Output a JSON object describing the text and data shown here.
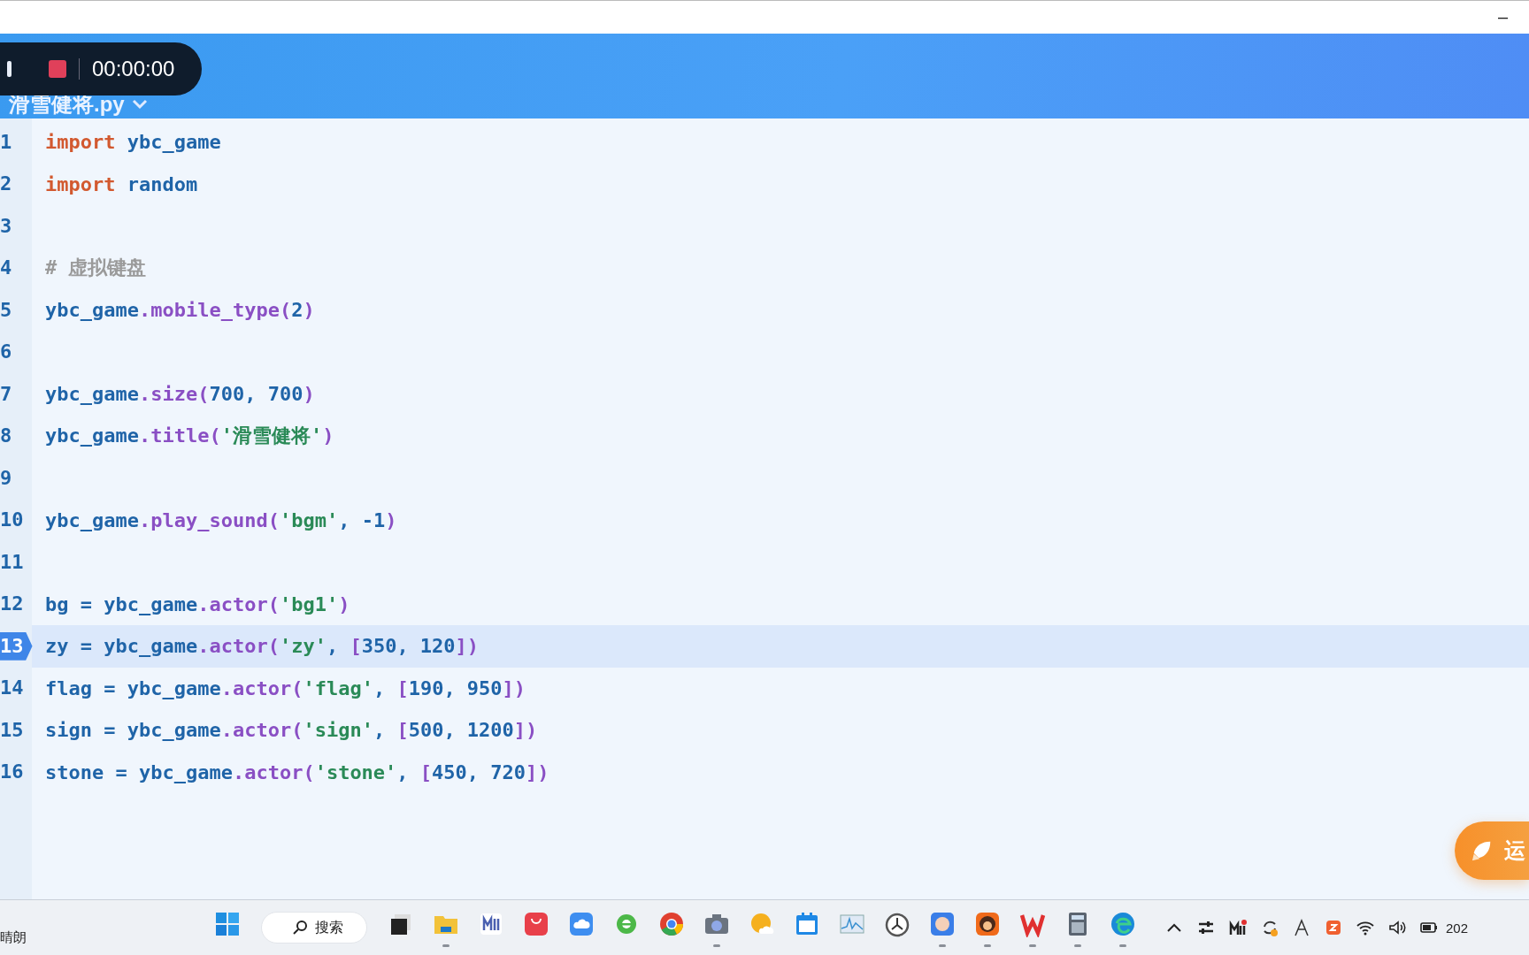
{
  "window": {
    "minimize": "–"
  },
  "recorder": {
    "time": "00:00:00"
  },
  "file_tab": {
    "title": "滑雪健将.py"
  },
  "editor": {
    "lines": [
      {
        "number": "1",
        "current": false,
        "tokens": [
          {
            "kind": "kw",
            "text": "import"
          },
          {
            "kind": "name",
            "text": " ybc_game"
          }
        ]
      },
      {
        "number": "2",
        "current": false,
        "tokens": [
          {
            "kind": "kw",
            "text": "import"
          },
          {
            "kind": "name",
            "text": " random"
          }
        ]
      },
      {
        "number": "3",
        "current": false
      },
      {
        "number": "4",
        "current": false,
        "tokens": [
          {
            "kind": "comment",
            "text": "# 虚拟键盘"
          }
        ]
      },
      {
        "number": "5",
        "current": false,
        "tokens": [
          {
            "kind": "name",
            "text": "ybc_game"
          },
          {
            "kind": "fn",
            "text": ".mobile_type("
          },
          {
            "kind": "num",
            "text": "2"
          },
          {
            "kind": "fn",
            "text": ")"
          }
        ]
      },
      {
        "number": "6",
        "current": false
      },
      {
        "number": "7",
        "current": false,
        "tokens": [
          {
            "kind": "name",
            "text": "ybc_game"
          },
          {
            "kind": "fn",
            "text": ".size("
          },
          {
            "kind": "num",
            "text": "700, 700"
          },
          {
            "kind": "fn",
            "text": ")"
          }
        ]
      },
      {
        "number": "8",
        "current": false,
        "tokens": [
          {
            "kind": "name",
            "text": "ybc_game"
          },
          {
            "kind": "fn",
            "text": ".title("
          },
          {
            "kind": "str",
            "text": "'滑雪健将'"
          },
          {
            "kind": "fn",
            "text": ")"
          }
        ]
      },
      {
        "number": "9",
        "current": false
      },
      {
        "number": "10",
        "current": false,
        "tokens": [
          {
            "kind": "name",
            "text": "ybc_game"
          },
          {
            "kind": "fn",
            "text": ".play_sound("
          },
          {
            "kind": "str",
            "text": "'bgm'"
          },
          {
            "kind": "num",
            "text": ", -1"
          },
          {
            "kind": "fn",
            "text": ")"
          }
        ]
      },
      {
        "number": "11",
        "current": false
      },
      {
        "number": "12",
        "current": false,
        "tokens": [
          {
            "kind": "name",
            "text": "bg = ybc_game"
          },
          {
            "kind": "fn",
            "text": ".actor("
          },
          {
            "kind": "str",
            "text": "'bg1'"
          },
          {
            "kind": "fn",
            "text": ")"
          }
        ]
      },
      {
        "number": "13",
        "current": true,
        "tokens": [
          {
            "kind": "name",
            "text": "zy = ybc_game"
          },
          {
            "kind": "fn",
            "text": ".actor("
          },
          {
            "kind": "str",
            "text": "'zy'"
          },
          {
            "kind": "num",
            "text": ", "
          },
          {
            "kind": "fn",
            "text": "["
          },
          {
            "kind": "num",
            "text": "350, 120"
          },
          {
            "kind": "fn",
            "text": "])"
          }
        ]
      },
      {
        "number": "14",
        "current": false,
        "tokens": [
          {
            "kind": "name",
            "text": "flag = ybc_game"
          },
          {
            "kind": "fn",
            "text": ".actor("
          },
          {
            "kind": "str",
            "text": "'flag'"
          },
          {
            "kind": "num",
            "text": ", "
          },
          {
            "kind": "fn",
            "text": "["
          },
          {
            "kind": "num",
            "text": "190, 950"
          },
          {
            "kind": "fn",
            "text": "])"
          }
        ]
      },
      {
        "number": "15",
        "current": false,
        "tokens": [
          {
            "kind": "name",
            "text": "sign = ybc_game"
          },
          {
            "kind": "fn",
            "text": ".actor("
          },
          {
            "kind": "str",
            "text": "'sign'"
          },
          {
            "kind": "num",
            "text": ", "
          },
          {
            "kind": "fn",
            "text": "["
          },
          {
            "kind": "num",
            "text": "500, 1200"
          },
          {
            "kind": "fn",
            "text": "])"
          }
        ]
      },
      {
        "number": "16",
        "current": false,
        "tokens": [
          {
            "kind": "name",
            "text": "stone = ybc_game"
          },
          {
            "kind": "fn",
            "text": ".actor("
          },
          {
            "kind": "str",
            "text": "'stone'"
          },
          {
            "kind": "num",
            "text": ", "
          },
          {
            "kind": "fn",
            "text": "["
          },
          {
            "kind": "num",
            "text": "450, 720"
          },
          {
            "kind": "fn",
            "text": "])"
          }
        ]
      }
    ]
  },
  "run_button": {
    "label": "运"
  },
  "taskbar": {
    "weather": "晴朗",
    "search": "搜索",
    "clock": "202",
    "apps": [
      {
        "running": false
      },
      {
        "running": true
      },
      {
        "running": false
      },
      {
        "running": false
      },
      {
        "running": false
      },
      {
        "running": false
      },
      {
        "running": false
      },
      {
        "running": true
      },
      {
        "running": false
      },
      {
        "running": false
      },
      {
        "running": false
      },
      {
        "running": false
      },
      {
        "running": true
      },
      {
        "running": true
      },
      {
        "running": true
      },
      {
        "running": true
      },
      {
        "running": true
      }
    ]
  }
}
